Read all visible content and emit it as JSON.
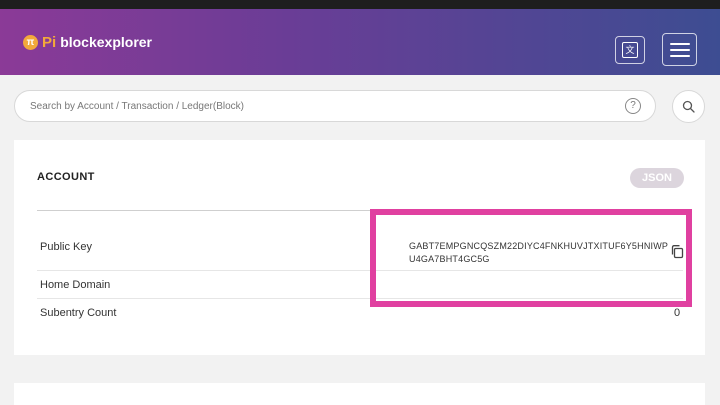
{
  "header": {
    "logo_symbol": "π",
    "logo_pi": "Pi",
    "logo_text": "blockexplorer",
    "language_icon": "language-icon",
    "menu_icon": "hamburger-menu-icon"
  },
  "search": {
    "placeholder": "Search by Account / Transaction / Ledger(Block)",
    "help_icon": "help-icon",
    "help_glyph": "?",
    "search_icon": "search-icon"
  },
  "account": {
    "title": "ACCOUNT",
    "json_label": "JSON",
    "rows": [
      {
        "label": "Public Key",
        "value": "GABT7EMPGNCQSZM22DIYC4FNKHUVJTXITUF6Y5HNIWPU4GA7BHT4GC5G"
      },
      {
        "label": "Home Domain",
        "value": ""
      },
      {
        "label": "Subentry Count",
        "value": "0"
      }
    ]
  },
  "colors": {
    "header_start": "#8b3a97",
    "header_end": "#3d4d92",
    "logo_accent": "#f2a93b",
    "highlight": "#e040a0"
  }
}
